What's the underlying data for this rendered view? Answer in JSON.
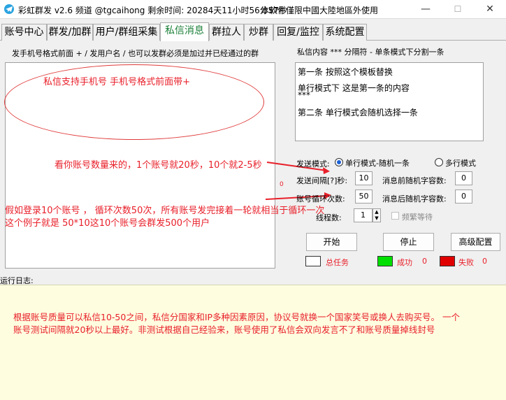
{
  "window": {
    "title": "彩虹群发 v2.6 频道 @tgcaihong   剩余时间: 20284天11小时56分57秒",
    "notice": "本軟件僅限中國大陸地區外使用",
    "min_glyph": "—",
    "max_glyph": "☐",
    "close_glyph": "✕"
  },
  "tabs": [
    {
      "label": "账号中心"
    },
    {
      "label": "群发/加群"
    },
    {
      "label": "用户/群组采集"
    },
    {
      "label": "私信消息",
      "active": true
    },
    {
      "label": "群拉人"
    },
    {
      "label": "炒群"
    },
    {
      "label": "回复/监控"
    },
    {
      "label": "系统配置"
    }
  ],
  "left": {
    "label": "发手机号格式前面 + / 发用户名 / 也可以发群必须是加过并已经通过的群",
    "note_ellipse": "私信支持手机号 手机号格式前面带+",
    "note_speed": "看你账号数量来的，1个账号就20秒，10个就2-5秒",
    "note_loop_1": "假如登录10个账号 ， 循环次数50次，所有账号发完接着一轮就相当于循环一次",
    "note_loop_2": "这个例子就是 50*10这10个账号会群发500个用户",
    "stray_mark": "0"
  },
  "right": {
    "label": "私信内容    *** 分隔符 -   单条模式下分割一条",
    "content_lines": [
      "第一条 按照这个模板替换",
      "单行模式下 这是第一条的内容",
      "***",
      "第二条 单行模式会随机选择一条"
    ],
    "send_mode_label": "发送模式:",
    "mode_single": "单行模式-随机一条",
    "mode_multi": "多行模式",
    "interval_label": "发送间隔[?]秒:",
    "interval_value": "10",
    "prefix_label": "消息前随机字容数:",
    "prefix_value": "0",
    "loop_label": "账号循环次数:",
    "loop_value": "50",
    "suffix_label": "消息后随机字容数:",
    "suffix_value": "0",
    "threads_label": "线程数:",
    "threads_value": "1",
    "busy_wait_label": "频繁等待",
    "start_button": "开始",
    "stop_button": "停止",
    "advanced_button": "高级配置",
    "total_label": "总任务",
    "success_label": "成功",
    "success_count": "0",
    "fail_label": "失败",
    "fail_count": "0",
    "colors": {
      "total": "#ffffff",
      "success": "#00e000",
      "fail": "#e00000"
    }
  },
  "log": {
    "label": "运行日志:",
    "line_1": "根据账号质量可以私信10-50之间，私信分国家和IP多种因素原因，协议号就换一个国家笑号或换人去购买号。 一个",
    "line_2": "账号测试间隔就20秒以上最好。非测试根据自己经验来，账号使用了私信会双向发言不了和账号质量掉线封号"
  }
}
